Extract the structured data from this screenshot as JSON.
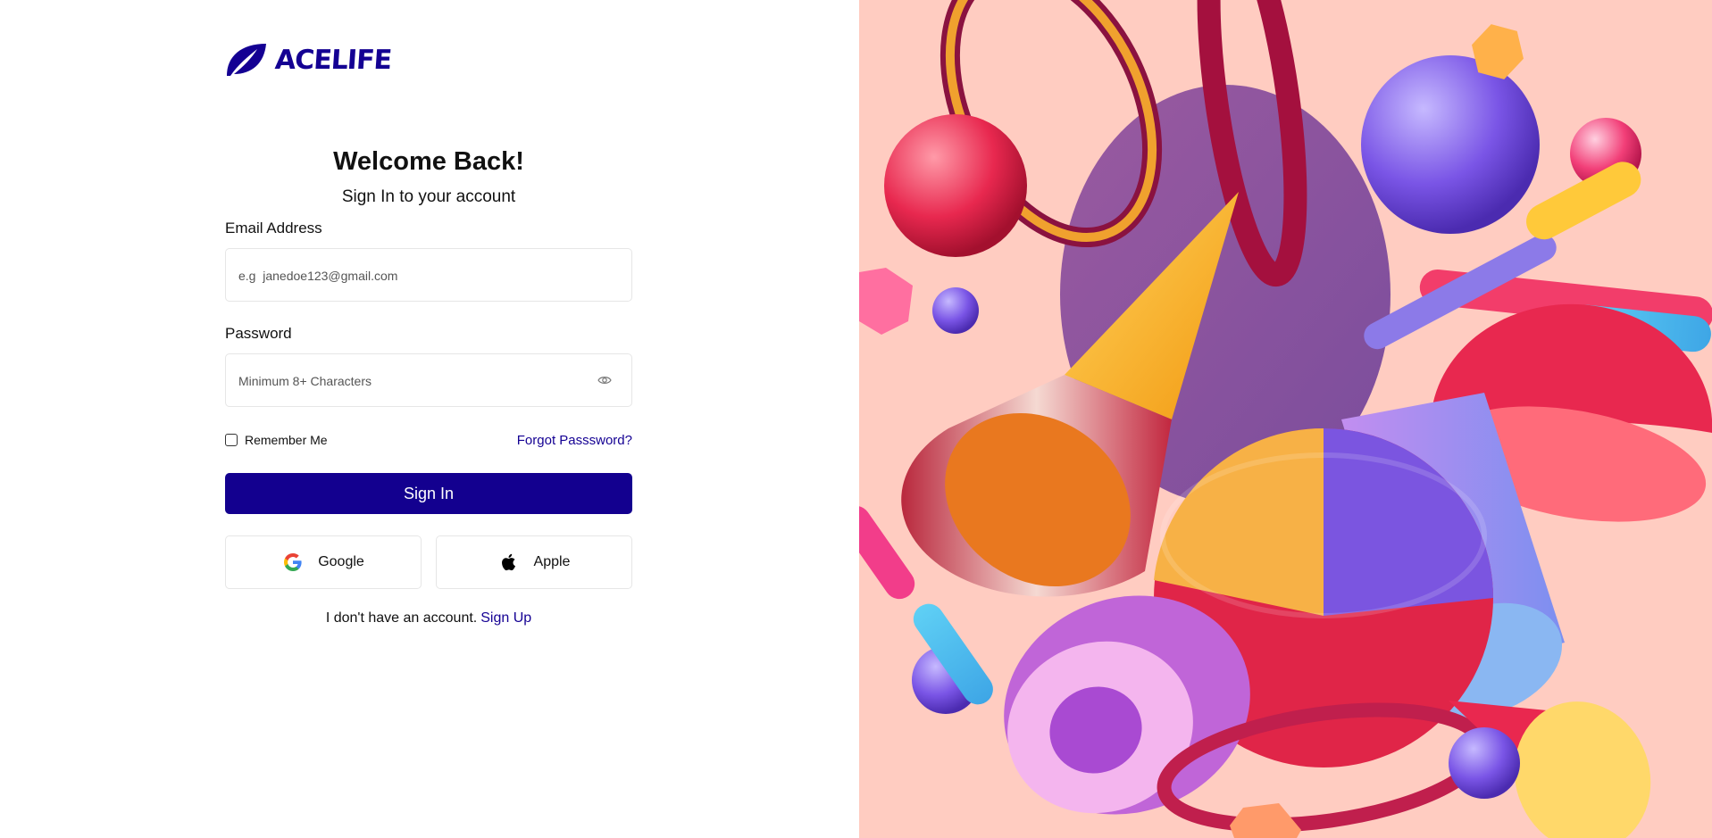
{
  "brand": {
    "name": "ACELIFE",
    "color": "#140093"
  },
  "login": {
    "title": "Welcome Back!",
    "subtitle": "Sign In to your account",
    "email_label": "Email Address",
    "email_placeholder": "e.g  janedoe123@gmail.com",
    "password_label": "Password",
    "password_placeholder": "Minimum 8+ Characters",
    "remember_label": "Remember Me",
    "remember_checked": false,
    "forgot_label": "Forgot Passsword?",
    "signin_label": "Sign In",
    "google_label": "Google",
    "apple_label": "Apple",
    "no_account_text": "I don't have an account.",
    "signup_label": "Sign Up"
  },
  "icons": {
    "logo": "leaf-logo-icon",
    "password_toggle": "eye-icon",
    "google": "google-icon",
    "apple": "apple-icon"
  },
  "colors": {
    "primary": "#13008f",
    "hero_background": "#ffccc1"
  }
}
